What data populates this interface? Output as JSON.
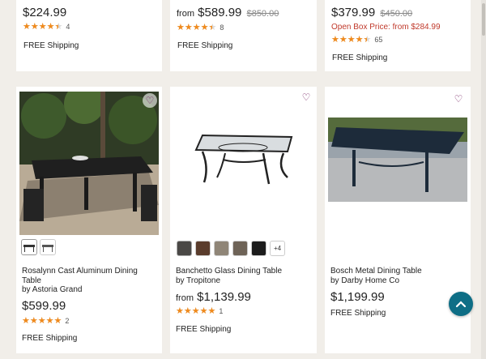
{
  "top_products": [
    {
      "price": "$224.99",
      "from_label": "",
      "original_price": "",
      "open_box": "",
      "rating": 4.5,
      "review_count": "4",
      "shipping": "FREE Shipping"
    },
    {
      "price": "$589.99",
      "from_label": "from",
      "original_price": "$850.00",
      "open_box": "",
      "rating": 4.5,
      "review_count": "8",
      "shipping": "FREE Shipping"
    },
    {
      "price": "$379.99",
      "from_label": "",
      "original_price": "$450.00",
      "open_box": "Open Box Price: from $284.99",
      "rating": 4.5,
      "review_count": "65",
      "shipping": "FREE Shipping"
    }
  ],
  "products": [
    {
      "name": "Rosalynn Cast Aluminum Dining Table",
      "brand": "by Astoria Grand",
      "from_label": "",
      "price": "$599.99",
      "rating": 5,
      "review_count": "2",
      "shipping": "FREE Shipping",
      "more_options": ""
    },
    {
      "name": "Banchetto Glass Dining Table",
      "brand": "by Tropitone",
      "from_label": "from",
      "price": "$1,139.99",
      "rating": 5,
      "review_count": "1",
      "shipping": "FREE Shipping",
      "more_options": "+4"
    },
    {
      "name": "Bosch Metal Dining Table",
      "brand": "by Darby Home Co",
      "from_label": "",
      "price": "$1,199.99",
      "rating": 0,
      "review_count": "",
      "shipping": "FREE Shipping",
      "more_options": ""
    }
  ],
  "swatch_colors": [
    "#4a4846",
    "#5a3c2c",
    "#8f8577",
    "#6e6357",
    "#1c1c1c"
  ],
  "colors": {
    "accent": "#0e6e86",
    "star": "#f08a1c",
    "sale_red": "#c0392b",
    "heart": "#7b2a68"
  },
  "icons": {
    "favorite": "heart-icon",
    "scroll_top": "chevron-up-icon",
    "rating": "star-icon"
  }
}
